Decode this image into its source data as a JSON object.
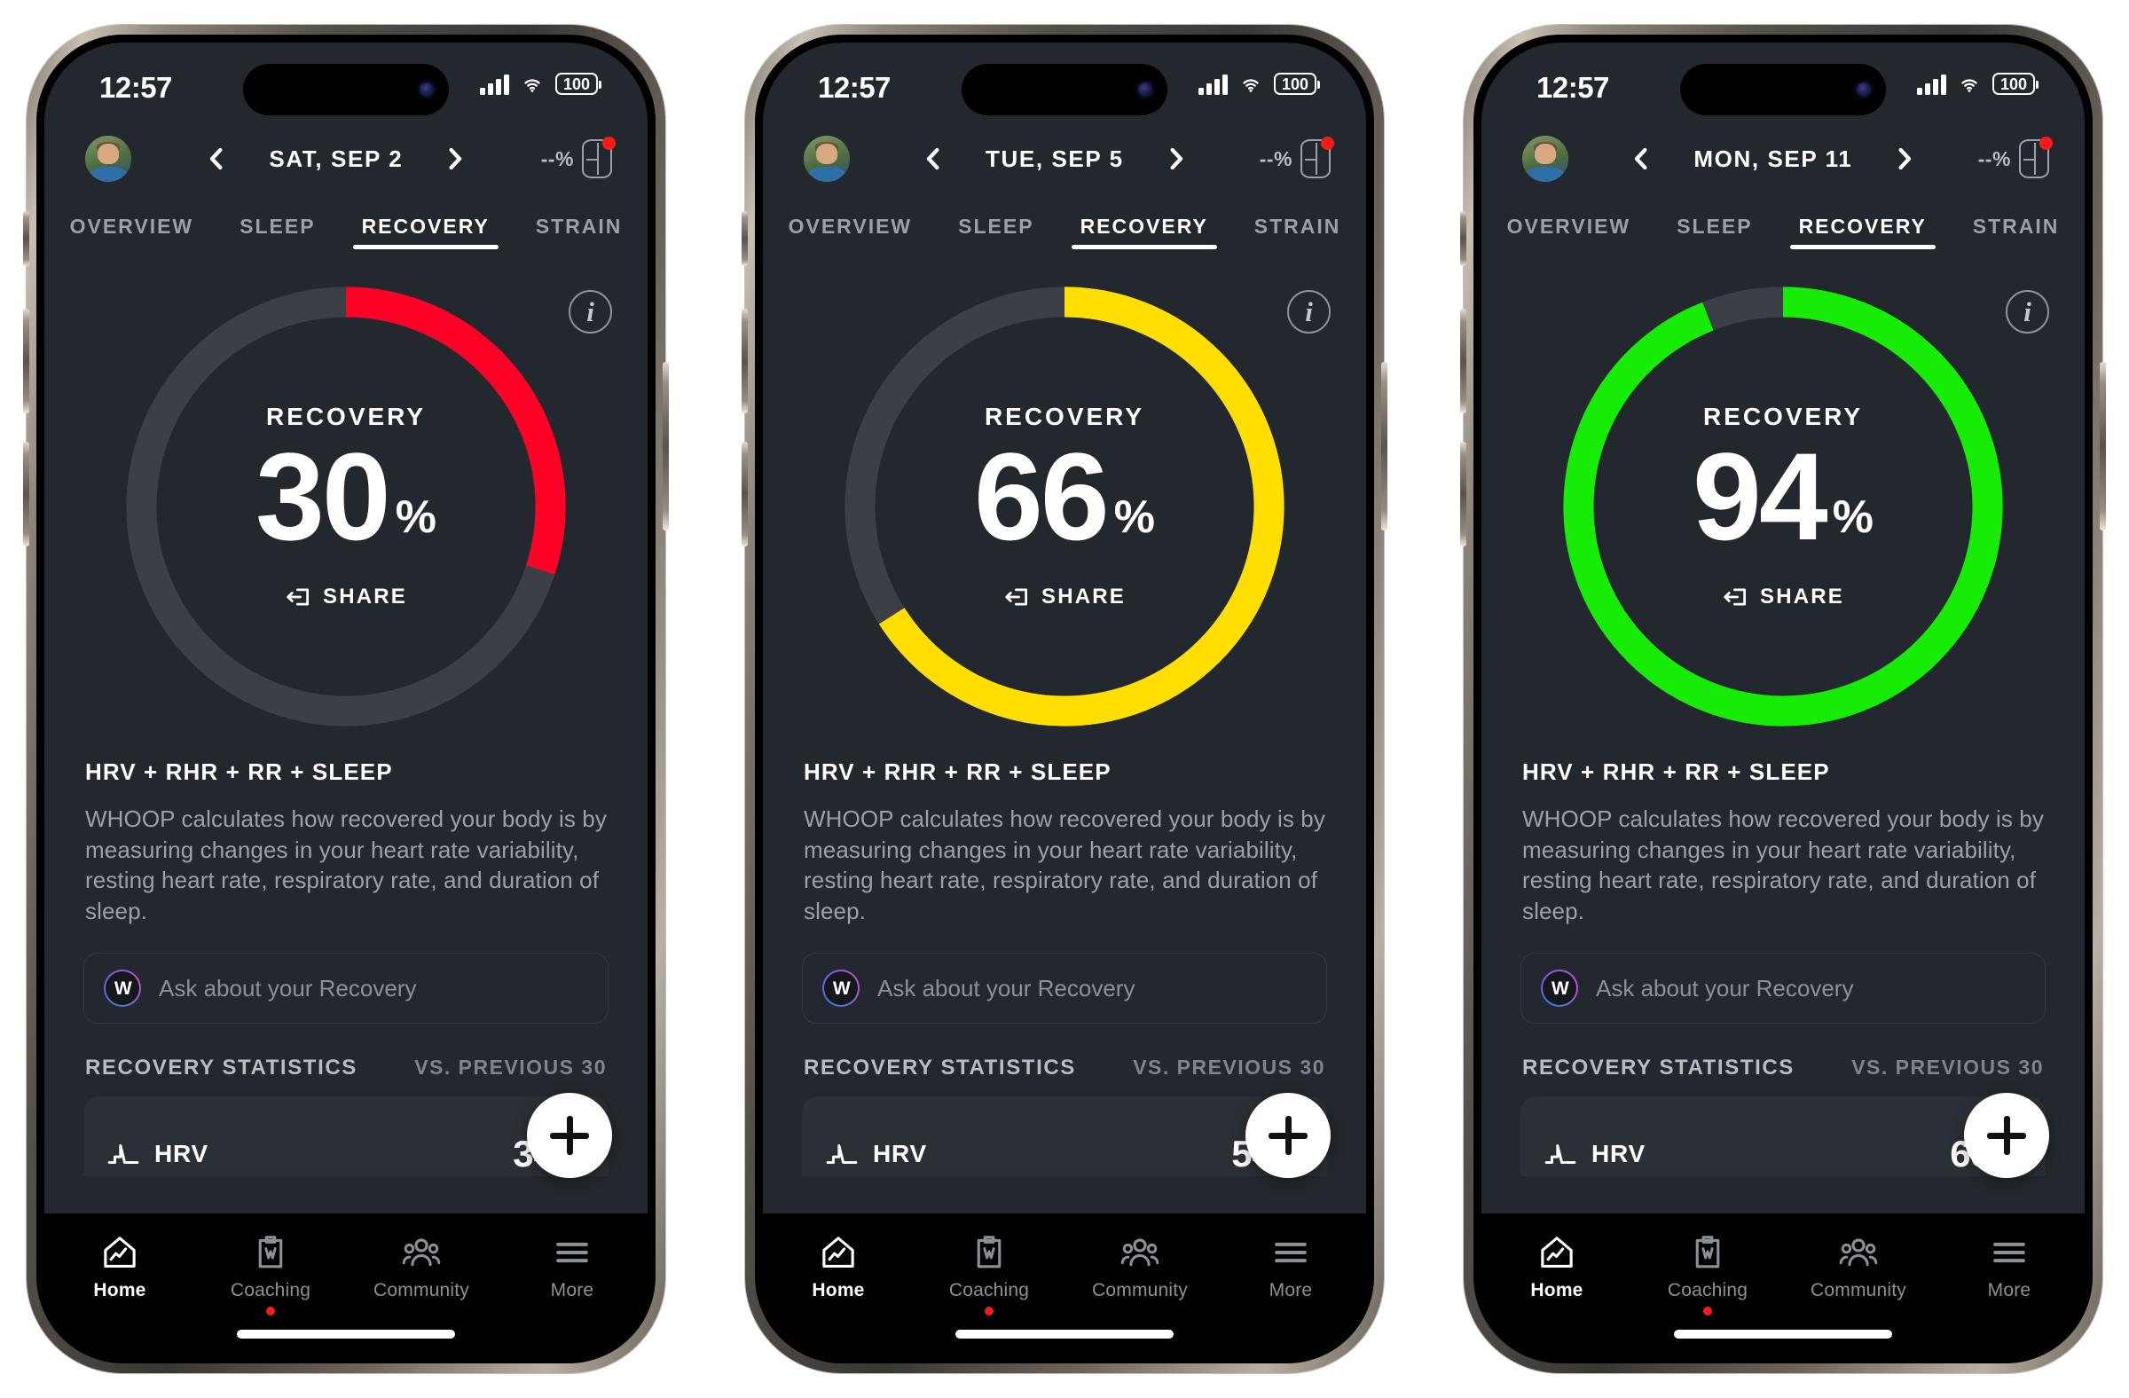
{
  "status_bar": {
    "time": "12:57",
    "battery_level": "100",
    "signal_icon": "cellular-signal-icon",
    "wifi_icon": "wifi-icon",
    "battery_icon": "battery-icon"
  },
  "common": {
    "avatar_name": "user-avatar",
    "prev_icon": "chevron-left-icon",
    "next_icon": "chevron-right-icon",
    "strap_battery": "--%",
    "strap_icon": "whoop-strap-icon",
    "tabs": [
      {
        "label": "OVERVIEW",
        "active": false
      },
      {
        "label": "SLEEP",
        "active": false
      },
      {
        "label": "RECOVERY",
        "active": true
      },
      {
        "label": "STRAIN",
        "active": false
      }
    ],
    "ring_label": "RECOVERY",
    "percent_symbol": "%",
    "share_label": "SHARE",
    "share_icon": "share-icon",
    "info_icon": "i",
    "desc_title": "HRV + RHR + RR + SLEEP",
    "desc_body": "WHOOP calculates how recovered your body is by measuring changes in your heart rate variability, resting heart rate, respiratory rate, and duration of sleep.",
    "ask_placeholder": "Ask about your Recovery",
    "ask_badge": "W",
    "stats_title": "RECOVERY STATISTICS",
    "stats_vs": "VS. PREVIOUS 30",
    "stat_row_label": "HRV",
    "stat_row_icon": "hrv-chart-icon",
    "fab_icon": "plus-icon",
    "ring_track_color": "#3b4046",
    "bottom_nav": [
      {
        "label": "Home",
        "icon": "home-icon",
        "active": true,
        "badge": false
      },
      {
        "label": "Coaching",
        "icon": "clipboard-coach-icon",
        "active": false,
        "badge": true
      },
      {
        "label": "Community",
        "icon": "community-people-icon",
        "active": false,
        "badge": false
      },
      {
        "label": "More",
        "icon": "hamburger-menu-icon",
        "active": false,
        "badge": false
      }
    ]
  },
  "phones": [
    {
      "date": "SAT, SEP 2",
      "recovery_value": "30",
      "recovery_percent": 30,
      "ring_color": "#FF0026",
      "hrv_value": "34",
      "hrv_trend": "down",
      "hrv_trend_color": "#f59b1c"
    },
    {
      "date": "TUE, SEP 5",
      "recovery_value": "66",
      "recovery_percent": 66,
      "ring_color": "#FFDE00",
      "hrv_value": "54",
      "hrv_trend": "down",
      "hrv_trend_color": "#f59b1c"
    },
    {
      "date": "MON, SEP 11",
      "recovery_value": "94",
      "recovery_percent": 94,
      "ring_color": "#16EC06",
      "hrv_value": "65",
      "hrv_trend": "up",
      "hrv_trend_color": "#0ac26a"
    }
  ]
}
